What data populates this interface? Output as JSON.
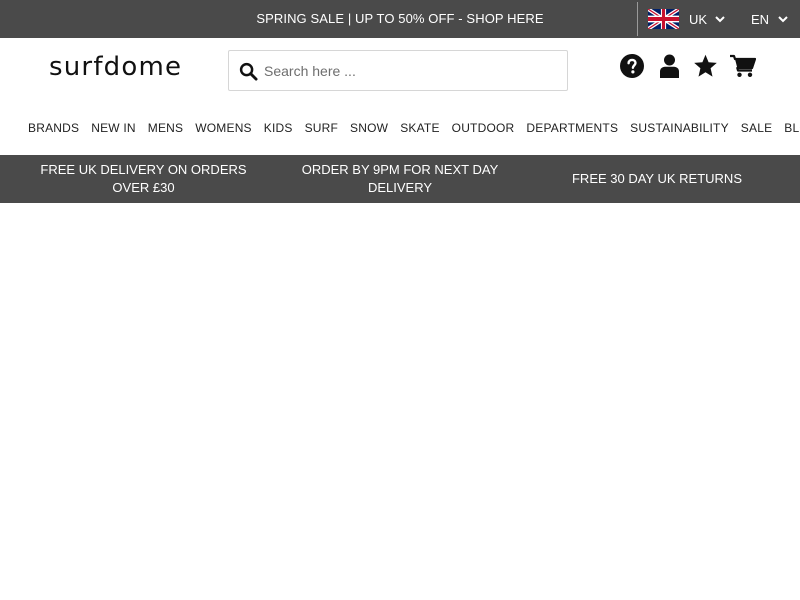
{
  "promo": {
    "text": "SPRING SALE | UP TO 50% OFF - SHOP HERE"
  },
  "locale": {
    "country": "UK",
    "language": "EN"
  },
  "header": {
    "logo": "surfdome",
    "search_placeholder": "Search here ..."
  },
  "nav": {
    "items": [
      {
        "label": "BRANDS"
      },
      {
        "label": "NEW IN"
      },
      {
        "label": "MENS"
      },
      {
        "label": "WOMENS"
      },
      {
        "label": "KIDS"
      },
      {
        "label": "SURF"
      },
      {
        "label": "SNOW"
      },
      {
        "label": "SKATE"
      },
      {
        "label": "OUTDOOR"
      },
      {
        "label": "DEPARTMENTS"
      },
      {
        "label": "SUSTAINABILITY"
      },
      {
        "label": "SALE"
      },
      {
        "label": "BLOG"
      }
    ]
  },
  "benefits": {
    "items": [
      {
        "text": "FREE UK DELIVERY ON ORDERS OVER £30"
      },
      {
        "text": "ORDER BY 9PM FOR NEXT DAY DELIVERY"
      },
      {
        "text": "FREE 30 DAY UK RETURNS"
      }
    ]
  },
  "icons": {
    "help": "help-icon",
    "account": "account-icon",
    "wishlist": "star-icon",
    "cart": "cart-icon",
    "search": "search-icon",
    "flag": "uk-flag-icon"
  },
  "colors": {
    "bar_background": "#4a4a4a",
    "bar_text": "#ffffff",
    "page_background": "#ffffff",
    "text": "#222222"
  }
}
